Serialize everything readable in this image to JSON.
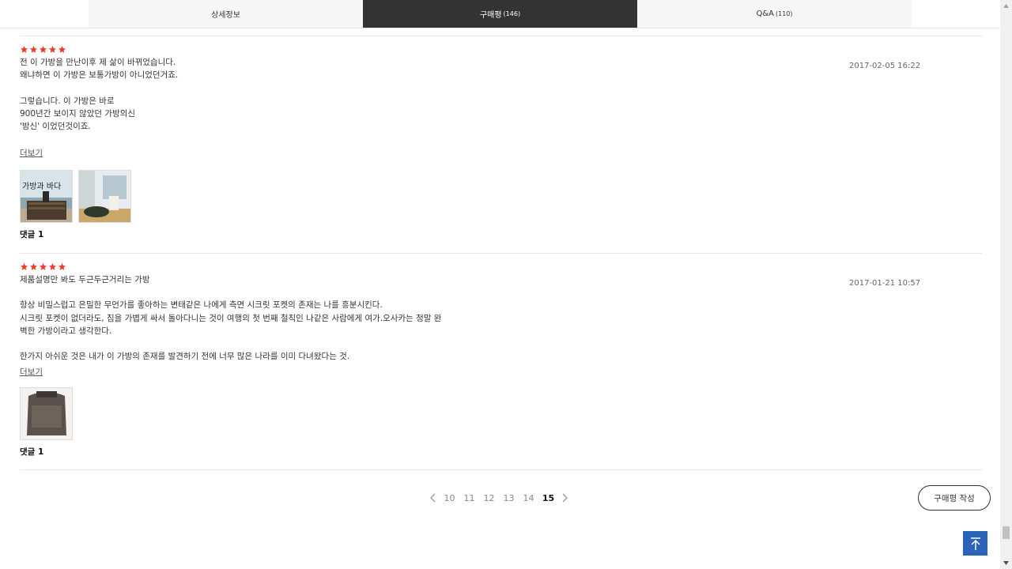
{
  "tabs": [
    {
      "label": "상세정보",
      "count": ""
    },
    {
      "label": "구매평",
      "count": "(146)"
    },
    {
      "label": "Q&A",
      "count": "(110)"
    }
  ],
  "reviews": [
    {
      "rating": 5,
      "body": "전 이 가방을 만난이후 제 삶이 바뀌었습니다.\n왜냐하면 이 가방은 보통가방이 아니었던거죠.\n\n그렇습니다. 이 가방은 바로\n900년간 보이지 않았던 가방의신\n'방신' 이었던것이죠.",
      "date": "2017-02-05 16:22",
      "more_label": "더보기",
      "thumbs": [
        "beach-bench-photo",
        "cafe-window-photo"
      ],
      "thumb_caption": "가방과 바다",
      "comments": "댓글 1"
    },
    {
      "rating": 5,
      "body": "제품설명만 봐도 두근두근거리는 가방\n\n항상 비밀스럽고 은밀한 무언가를 좋아하는 변태같은 나에게 측면 시크릿 포켓의 존재는 나를 흥분시킨다.\n시크릿 포켓이 없더라도, 짐을 가볍게 싸서 돌아다니는 것이 여행의 첫 번째 철칙인 나같은 사람에게 여가.오사카는 정말 완\n벽한 가방이라고 생각한다.\n\n한가지 아쉬운 것은 내가 이 가방의 존재를 발견하기 전에 너무 많은 나라를 이미 다녀왔다는 것.",
      "date": "2017-01-21 10:57",
      "more_label": "더보기",
      "thumbs": [
        "backpack-photo"
      ],
      "thumb_caption": "",
      "comments": "댓글 1"
    }
  ],
  "pagination": {
    "pages": [
      "10",
      "11",
      "12",
      "13",
      "14",
      "15"
    ],
    "current": "15"
  },
  "write_button": "구매평 작성",
  "colors": {
    "star": "#e8402f",
    "active_tab": "#333333",
    "top_button": "#2b63b8"
  }
}
